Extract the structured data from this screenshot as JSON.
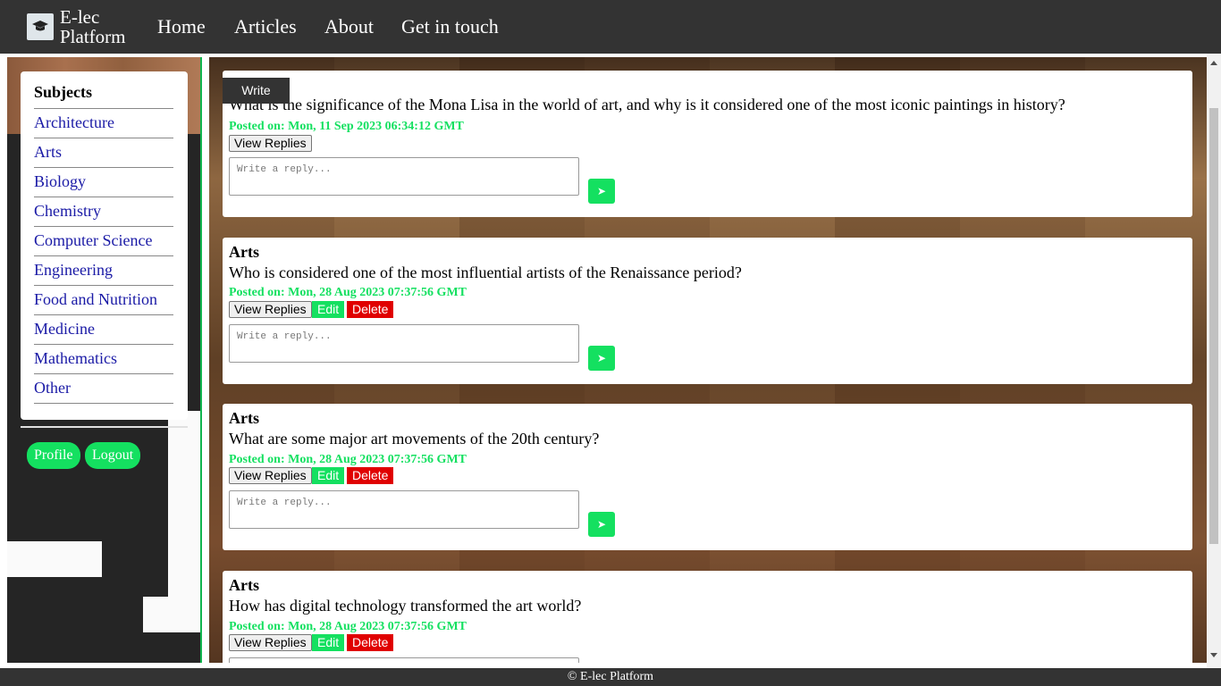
{
  "brand": {
    "line1": "E-lec",
    "line2": "Platform",
    "icon": "graduation-cap-icon"
  },
  "nav": [
    "Home",
    "Articles",
    "About",
    "Get in touch"
  ],
  "sidebar": {
    "title": "Subjects",
    "subjects": [
      "Architecture",
      "Arts",
      "Biology",
      "Chemistry",
      "Computer Science",
      "Engineering",
      "Food and Nutrition",
      "Medicine",
      "Mathematics",
      "Other"
    ],
    "profile_label": "Profile",
    "logout_label": "Logout"
  },
  "write_label": "Write",
  "buttons": {
    "view_replies": "View Replies",
    "edit": "Edit",
    "delete": "Delete",
    "send": "➤"
  },
  "reply_placeholder": "Write a reply...",
  "posts": [
    {
      "category": "",
      "question": "What is the significance of the Mona Lisa in the world of art, and why is it considered one of the most iconic paintings in history?",
      "date": "Posted on: Mon, 11 Sep 2023 06:34:12 GMT"
    },
    {
      "category": "Arts",
      "question": "Who is considered one of the most influential artists of the Renaissance period?",
      "date": "Posted on: Mon, 28 Aug 2023 07:37:56 GMT"
    },
    {
      "category": "Arts",
      "question": "What are some major art movements of the 20th century?",
      "date": "Posted on: Mon, 28 Aug 2023 07:37:56 GMT"
    },
    {
      "category": "Arts",
      "question": "How has digital technology transformed the art world?",
      "date": "Posted on: Mon, 28 Aug 2023 07:37:56 GMT"
    }
  ],
  "footer": "© E-lec Platform",
  "colors": {
    "accent": "#14e060",
    "danger": "#e00000",
    "bar": "#333333",
    "link": "#1a1aa6"
  }
}
